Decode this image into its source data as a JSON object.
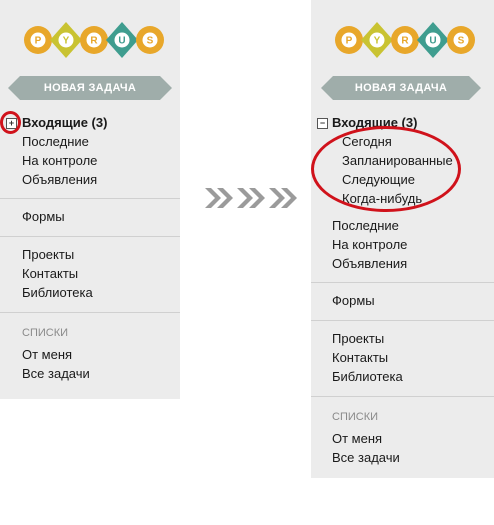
{
  "app": {
    "logo_letters": [
      "P",
      "Y",
      "R",
      "U",
      "S"
    ],
    "logo_colors": [
      "#e8a72a",
      "#c9c332",
      "#e8a72a",
      "#3f9d8f",
      "#e8a72a"
    ]
  },
  "before": {
    "new_task_label": "НОВАЯ ЗАДАЧА",
    "inbox_toggle": "+",
    "inbox_label": "Входящие (3)",
    "items_group1": [
      "Последние",
      "На контроле",
      "Объявления"
    ],
    "forms_label": "Формы",
    "items_group2": [
      "Проекты",
      "Контакты",
      "Библиотека"
    ],
    "lists_caption": "СПИСКИ",
    "items_group3": [
      "От меня",
      "Все задачи"
    ]
  },
  "after": {
    "new_task_label": "НОВАЯ ЗАДАЧА",
    "inbox_toggle": "−",
    "inbox_label": "Входящие (3)",
    "inbox_subitems": [
      "Сегодня",
      "Запланированные",
      "Следующие",
      "Когда-нибудь"
    ],
    "items_group1": [
      "Последние",
      "На контроле",
      "Объявления"
    ],
    "forms_label": "Формы",
    "items_group2": [
      "Проекты",
      "Контакты",
      "Библиотека"
    ],
    "lists_caption": "СПИСКИ",
    "items_group3": [
      "От меня",
      "Все задачи"
    ]
  },
  "colors": {
    "highlight": "#d0121b",
    "arrows": "#9b9b9b",
    "button": "#9fadaa",
    "panel": "#ececec"
  }
}
